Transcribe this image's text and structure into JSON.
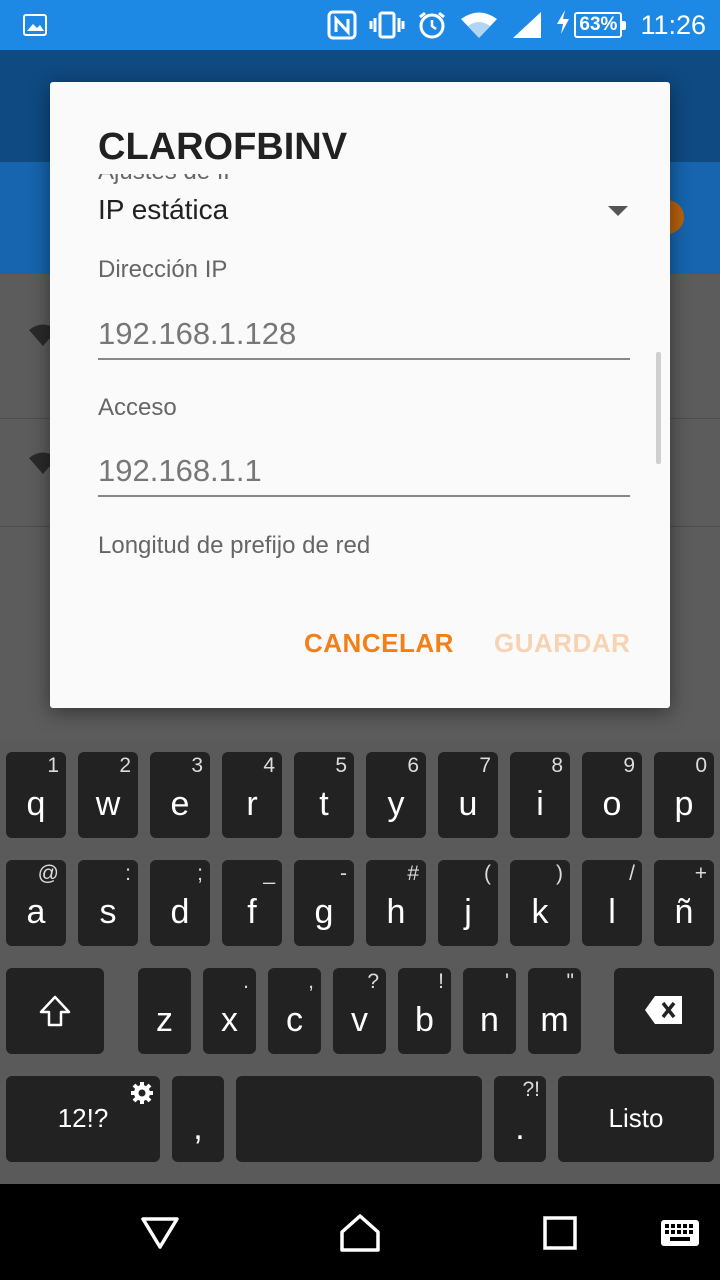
{
  "status_bar": {
    "battery_text": "63%",
    "time": "11:26",
    "icons": [
      "image-icon",
      "nfc-icon",
      "vibrate-icon",
      "alarm-icon",
      "wifi-icon",
      "signal-icon",
      "charging-icon",
      "battery-icon"
    ]
  },
  "dialog": {
    "title": "CLAROFBINV",
    "cut_label": "Ajustes de IP",
    "ip_settings_value": "IP estática",
    "ip_address": {
      "label": "Dirección IP",
      "value": "192.168.1.128"
    },
    "gateway": {
      "label": "Acceso",
      "value": "192.168.1.1"
    },
    "prefix_label": "Longitud de prefijo de red",
    "cancel_label": "CANCELAR",
    "save_label": "GUARDAR"
  },
  "keyboard": {
    "row1": [
      {
        "k": "q",
        "h": "1"
      },
      {
        "k": "w",
        "h": "2"
      },
      {
        "k": "e",
        "h": "3"
      },
      {
        "k": "r",
        "h": "4"
      },
      {
        "k": "t",
        "h": "5"
      },
      {
        "k": "y",
        "h": "6"
      },
      {
        "k": "u",
        "h": "7"
      },
      {
        "k": "i",
        "h": "8"
      },
      {
        "k": "o",
        "h": "9"
      },
      {
        "k": "p",
        "h": "0"
      }
    ],
    "row2": [
      {
        "k": "a",
        "h": "@"
      },
      {
        "k": "s",
        "h": ":"
      },
      {
        "k": "d",
        "h": ";"
      },
      {
        "k": "f",
        "h": "_"
      },
      {
        "k": "g",
        "h": "-"
      },
      {
        "k": "h",
        "h": "#"
      },
      {
        "k": "j",
        "h": "("
      },
      {
        "k": "k",
        "h": ")"
      },
      {
        "k": "l",
        "h": "/"
      },
      {
        "k": "ñ",
        "h": "+"
      }
    ],
    "row3": [
      {
        "k": "z",
        "h": ""
      },
      {
        "k": "x",
        "h": "."
      },
      {
        "k": "c",
        "h": ","
      },
      {
        "k": "v",
        "h": "?"
      },
      {
        "k": "b",
        "h": "!"
      },
      {
        "k": "n",
        "h": "'"
      },
      {
        "k": "m",
        "h": "\""
      }
    ],
    "symbols_label": "12!?",
    "comma_label": ",",
    "period_label": ".",
    "period_hint": "?!",
    "done_label": "Listo"
  },
  "nav_bar": {
    "icons": [
      "back-icon",
      "home-icon",
      "recents-icon",
      "keyboard-icon"
    ]
  }
}
